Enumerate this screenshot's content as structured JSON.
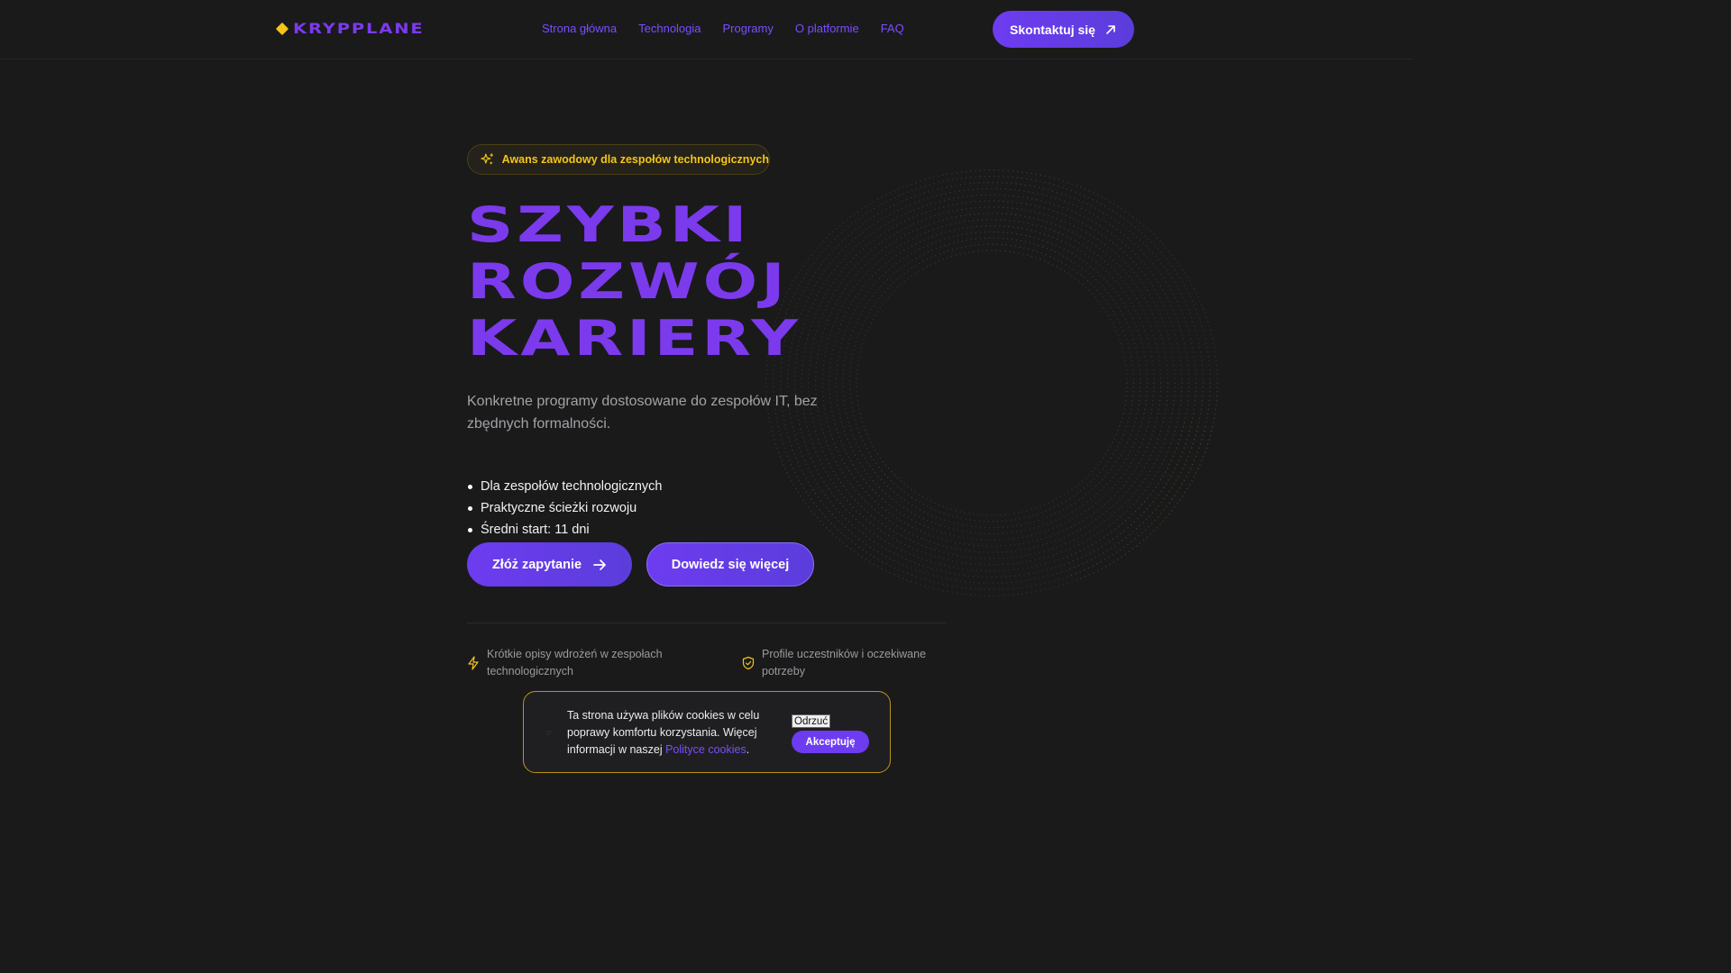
{
  "header": {
    "logo": "KRYPPLANE",
    "nav": [
      "Strona główna",
      "Technologia",
      "Programy",
      "O platformie",
      "FAQ"
    ],
    "contact_label": "Skontaktuj się"
  },
  "hero": {
    "badge": "Awans zawodowy dla zespołów technologicznych",
    "title_lines": [
      "SZYBKI",
      "ROZWÓJ",
      "KARIERY"
    ],
    "subtitle": "Konkretne programy dostosowane do zespołów IT, bez zbędnych formalności.",
    "bullets": [
      "Dla zespołów technologicznych",
      "Praktyczne ścieżki rozwoju",
      "Średni start: 11 dni"
    ],
    "primary_cta": "Złóż zapytanie",
    "secondary_cta": "Dowiedz się więcej",
    "features": [
      "Krótkie opisy wdrożeń w zespołach technologicznych",
      "Profile uczestników i oczekiwane potrzeby"
    ]
  },
  "cookie": {
    "text_before": "Ta strona używa plików cookies w celu poprawy komfortu korzystania. Więcej informacji w naszej ",
    "link": "Polityce cookies",
    "text_after": ".",
    "reject": "Odrzuć",
    "accept": "Akceptuję"
  },
  "colors": {
    "accent": "#7c3aed",
    "highlight": "#f5c518",
    "background": "#1a1a1b"
  }
}
